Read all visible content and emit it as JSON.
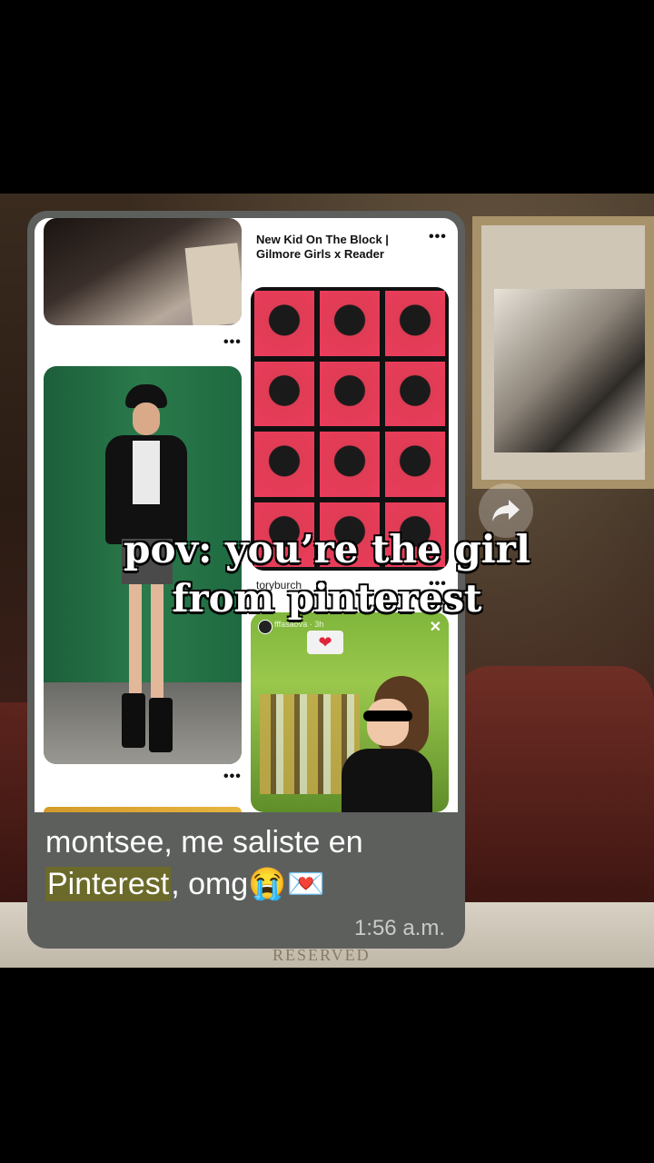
{
  "pins": {
    "title": "New Kid On The Block | Gilmore Girls x Reader",
    "source_label": "toryburch",
    "story_handle": "fffasaova · 3h",
    "more_glyph": "•••"
  },
  "message": {
    "text_before": "montsee, me saliste en ",
    "highlight": "Pinterest",
    "text_after": ", omg😭💌",
    "time": "1:56 a.m."
  },
  "caption": {
    "line1": "pov: you’re the girl",
    "line2": "from pinterest"
  },
  "icons": {
    "share": "share-arrow-icon",
    "more": "more-dots-icon",
    "close": "close-icon"
  },
  "colors": {
    "bubble": "#5d5f5d",
    "highlight": "#6b6a2a"
  }
}
